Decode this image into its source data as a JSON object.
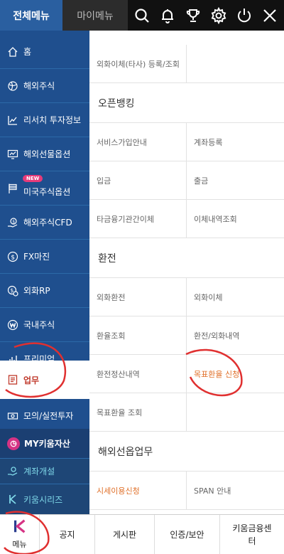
{
  "header": {
    "tab_all": "전체메뉴",
    "tab_my": "마이메뉴",
    "icons": [
      "search-icon",
      "bell-icon",
      "trophy-icon",
      "gear-icon",
      "power-icon",
      "close-icon"
    ]
  },
  "sidebar": {
    "items": [
      {
        "label": "홈",
        "icon": "home-icon"
      },
      {
        "label": "해외주식",
        "icon": "globe-icon"
      },
      {
        "label": "리서치 투자정보",
        "icon": "chart-line-icon"
      },
      {
        "label": "해외선물옵션",
        "icon": "monitor-chart-icon"
      },
      {
        "label": "미국주식옵션",
        "icon": "flag-icon",
        "badge": "NEW"
      },
      {
        "label": "해외주식CFD",
        "icon": "dollar-hand-icon"
      },
      {
        "label": "FX마진",
        "icon": "dollar-circle-icon"
      },
      {
        "label": "외화RP",
        "icon": "dollar-clock-icon"
      },
      {
        "label": "국내주식",
        "icon": "won-circle-icon"
      },
      {
        "label": "프리미엄",
        "icon": "bar-chart-icon"
      },
      {
        "label": "업무",
        "icon": "document-icon"
      },
      {
        "label": "모의/실전투자",
        "icon": "money-icon"
      },
      {
        "label": "MY키움자산",
        "icon": "pie-icon"
      },
      {
        "label": "계좌개설",
        "icon": "hand-icon"
      },
      {
        "label": "키움시리즈",
        "icon": "k-icon"
      }
    ]
  },
  "content": {
    "top_row": [
      "외화이체(타사) 등록/조회",
      ""
    ],
    "sections": [
      {
        "title": "오픈뱅킹",
        "rows": [
          [
            "서비스가입안내",
            "계좌등록"
          ],
          [
            "입금",
            "출금"
          ],
          [
            "타금융기관간이체",
            "이체내역조회"
          ]
        ]
      },
      {
        "title": "환전",
        "rows": [
          [
            "외화환전",
            "외화이체"
          ],
          [
            "환율조회",
            "환전/외화내역"
          ],
          [
            "환전정산내역",
            "목표환율 신청"
          ],
          [
            "목표환율 조회",
            ""
          ]
        ]
      },
      {
        "title": "해외선옵업무",
        "rows": [
          [
            "시세이용신청",
            "SPAN 안내"
          ]
        ]
      }
    ]
  },
  "bottom_nav": {
    "menu_label": "메뉴",
    "items": [
      "공지",
      "게시판",
      "인증/보안",
      "키움금융센터"
    ]
  },
  "colors": {
    "sidebar_bg": "#1f4f8e",
    "tab_active": "#2a5fa0",
    "highlight_text": "#e0712b",
    "active_text": "#c0392b",
    "annotation": "#e03030"
  }
}
